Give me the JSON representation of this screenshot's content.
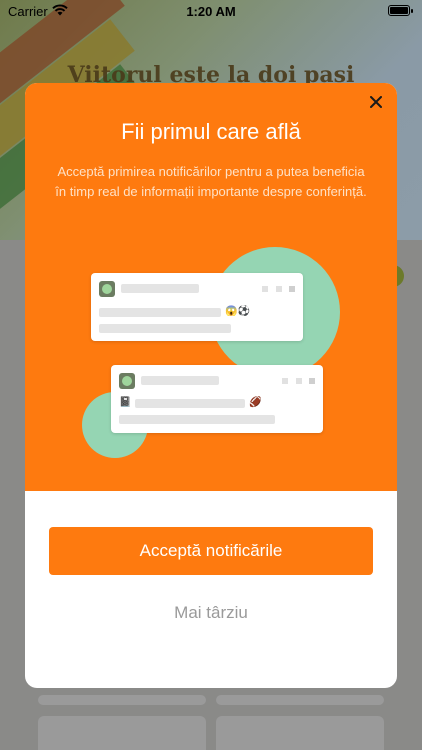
{
  "status_bar": {
    "carrier": "Carrier",
    "time": "1:20 AM"
  },
  "background": {
    "banner_title": "Viitorul este la doi pași"
  },
  "modal": {
    "title": "Fii primul care află",
    "description": "Acceptă primirea notificărilor pentru a putea beneficia în timp real de informații importante despre conferință.",
    "close_icon": "close-icon",
    "primary_button": "Acceptă notificările",
    "secondary_button": "Mai târziu",
    "illustration": {
      "card1_emoji": "😱⚽",
      "card2_emoji": "🏈",
      "card2_leading_emoji": "📓"
    }
  },
  "colors": {
    "accent": "#fe7a0f",
    "mint": "#95d5b3",
    "description_text": "#ffe1c6",
    "muted_text": "#9a9a9a"
  }
}
